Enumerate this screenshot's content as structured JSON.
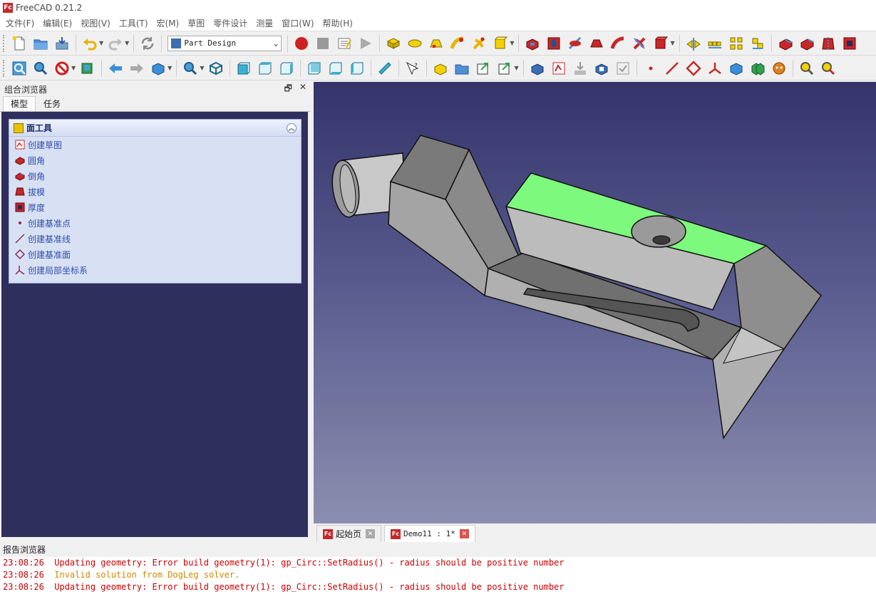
{
  "window": {
    "title": "FreeCAD 0.21.2",
    "app_icon": "Fc"
  },
  "menu": [
    "文件(F)",
    "编辑(E)",
    "视图(V)",
    "工具(T)",
    "宏(M)",
    "草图",
    "零件设计",
    "测量",
    "窗口(W)",
    "帮助(H)"
  ],
  "workbench": {
    "selected": "Part Design"
  },
  "left_panel": {
    "title": "组合浏览器",
    "tabs": [
      "模型",
      "任务"
    ],
    "taskbox": {
      "title": "面工具",
      "items": [
        {
          "label": "创建草图",
          "icon": "sketch-icon"
        },
        {
          "label": "圆角",
          "icon": "fillet-icon"
        },
        {
          "label": "倒角",
          "icon": "chamfer-icon"
        },
        {
          "label": "拔模",
          "icon": "draft-icon"
        },
        {
          "label": "厚度",
          "icon": "thickness-icon"
        },
        {
          "label": "创建基准点",
          "icon": "datum-point-icon"
        },
        {
          "label": "创建基准线",
          "icon": "datum-line-icon"
        },
        {
          "label": "创建基准面",
          "icon": "datum-plane-icon"
        },
        {
          "label": "创建局部坐标系",
          "icon": "local-cs-icon"
        }
      ]
    }
  },
  "doc_tabs": [
    {
      "label": "起始页",
      "active": false
    },
    {
      "label": "Demo11 : 1*",
      "active": true
    }
  ],
  "report": {
    "title": "报告浏览器",
    "lines": [
      {
        "time": "23:08:26",
        "msg": "Updating geometry: Error build geometry(1): gp_Circ::SetRadius() - radius should be positive number",
        "level": "error"
      },
      {
        "time": "23:08:26",
        "msg": "Invalid solution from DogLeg solver.",
        "level": "warning"
      },
      {
        "time": "23:08:26",
        "msg": "Updating geometry: Error build geometry(1): gp_Circ::SetRadius() - radius should be positive number",
        "level": "error"
      }
    ]
  },
  "colors": {
    "viewport_top": "#34346a",
    "viewport_bottom": "#8c8eb0",
    "selected_face": "#7dfa7d",
    "error_text": "#cc0000",
    "warning_text": "#d08a00"
  }
}
